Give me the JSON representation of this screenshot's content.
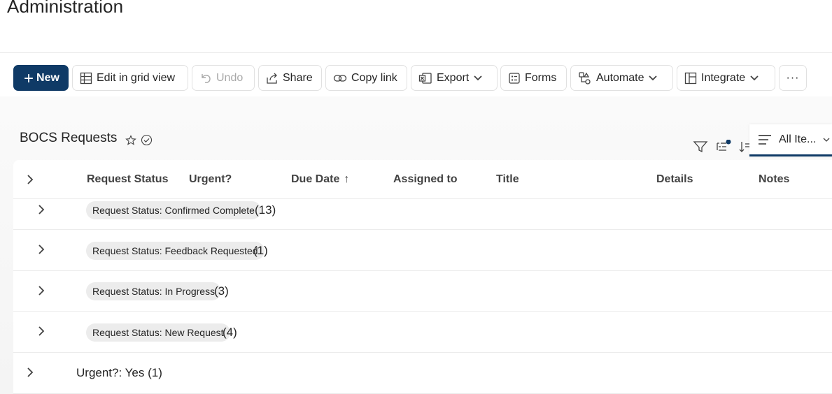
{
  "page": {
    "title": "Administration"
  },
  "toolbar": {
    "new_label": "New",
    "edit_grid_label": "Edit in grid view",
    "undo_label": "Undo",
    "share_label": "Share",
    "copy_link_label": "Copy link",
    "export_label": "Export",
    "forms_label": "Forms",
    "automate_label": "Automate",
    "integrate_label": "Integrate",
    "more_label": "···"
  },
  "list": {
    "title": "BOCS Requests",
    "view_name": "All Ite...",
    "columns": [
      {
        "label": "Request Status"
      },
      {
        "label": "Urgent?"
      },
      {
        "label": "Due Date"
      },
      {
        "label": "Assigned to"
      },
      {
        "label": "Title"
      },
      {
        "label": "Details"
      },
      {
        "label": "Notes"
      }
    ],
    "due_date_sort": "↑",
    "groups": [
      {
        "label": "Request Status: Confirmed Complete",
        "count": "(13)"
      },
      {
        "label": "Request Status: Feedback Requested",
        "count": "(1)"
      },
      {
        "label": "Request Status: In Progress",
        "count": "(3)"
      },
      {
        "label": "Request Status: New Request",
        "count": "(4)"
      }
    ],
    "outer_group": {
      "label": "Urgent?: Yes (1)"
    }
  },
  "colors": {
    "accent": "#0f3a66",
    "filter_dot": "#0f3a66"
  },
  "icons": [
    "grid-icon",
    "undo-icon",
    "share-icon",
    "link-icon",
    "excel-icon",
    "forms-icon",
    "automate-icon",
    "integrate-icon",
    "star-icon",
    "check-circle-icon",
    "filter-icon",
    "group-icon",
    "sort-icon",
    "view-list-icon",
    "chevron-right-icon",
    "chevron-down-icon"
  ]
}
